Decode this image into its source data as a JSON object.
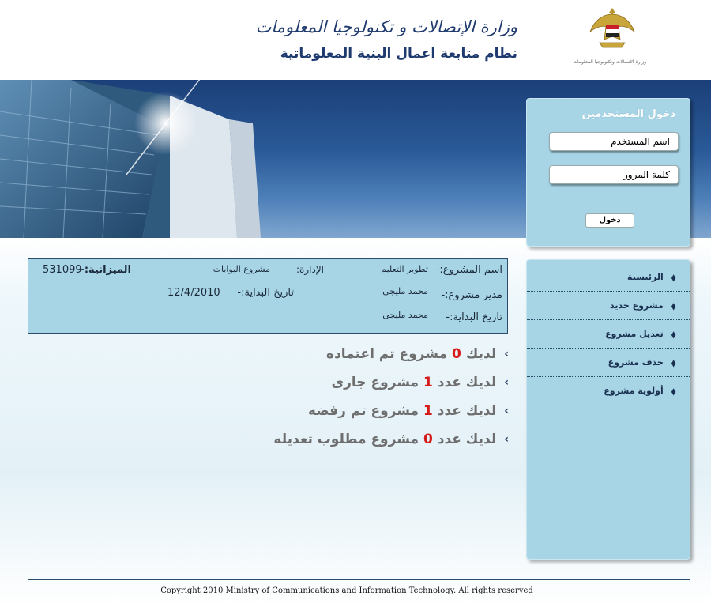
{
  "header": {
    "title": "وزارة الإتصالات و تكنولوجيا المعلومات",
    "subtitle": "نظام متابعة اعمال البنية المعلوماتية",
    "emblem_caption": "وزارة الاتصالات وتكنولوجيا المعلومات",
    "emblem_icon": "egypt-eagle-emblem"
  },
  "login": {
    "title": "دخول المستخدمين",
    "username_value": "اسم المستخدم",
    "password_value": "كلمة المرور",
    "submit_label": "دخول"
  },
  "nav": {
    "bullet_icon": "diamond-bullet",
    "items": [
      {
        "label": "الرئيسية"
      },
      {
        "label": "مشروع جديد"
      },
      {
        "label": "تعديل مشروع"
      },
      {
        "label": "حذف مشروع"
      },
      {
        "label": "أولوية مشروع"
      }
    ]
  },
  "project": {
    "name_label": "اسم المشروع:-",
    "name_value": "تطوير التعليم",
    "department_label": "الإدارة:-",
    "department_value": "مشروع البوابات",
    "budget_label": "الميزانية:-",
    "budget_value": "531099",
    "manager_label": "مدير مشروع:-",
    "manager_value": "محمد مليجى",
    "start_date_label": "تاريخ البداية:-",
    "start_date_value": "12/4/2010",
    "start_date_label2": "تاريخ البداية:-",
    "start_date_value2": "محمد مليجى"
  },
  "status": [
    {
      "prefix": "لديك",
      "count": "0",
      "suffix": "مشروع تم اعتماده"
    },
    {
      "prefix": "لديك  عدد",
      "count": "1",
      "suffix": "مشروع جارى"
    },
    {
      "prefix": "لديك عدد",
      "count": "1",
      "suffix": "مشروع تم رفضه"
    },
    {
      "prefix": "لديك عدد",
      "count": "0",
      "suffix": "مشروع مطلوب  تعديله"
    }
  ],
  "status_arrow_icon": "chevron-left-icon",
  "footer": {
    "copyright": "Copyright 2010 Ministry of Communications and Information Technology. All rights  reserved"
  },
  "colors": {
    "panel": "#a7d5e6",
    "navy": "#1f3a6e",
    "count_red": "#d61b1b"
  }
}
